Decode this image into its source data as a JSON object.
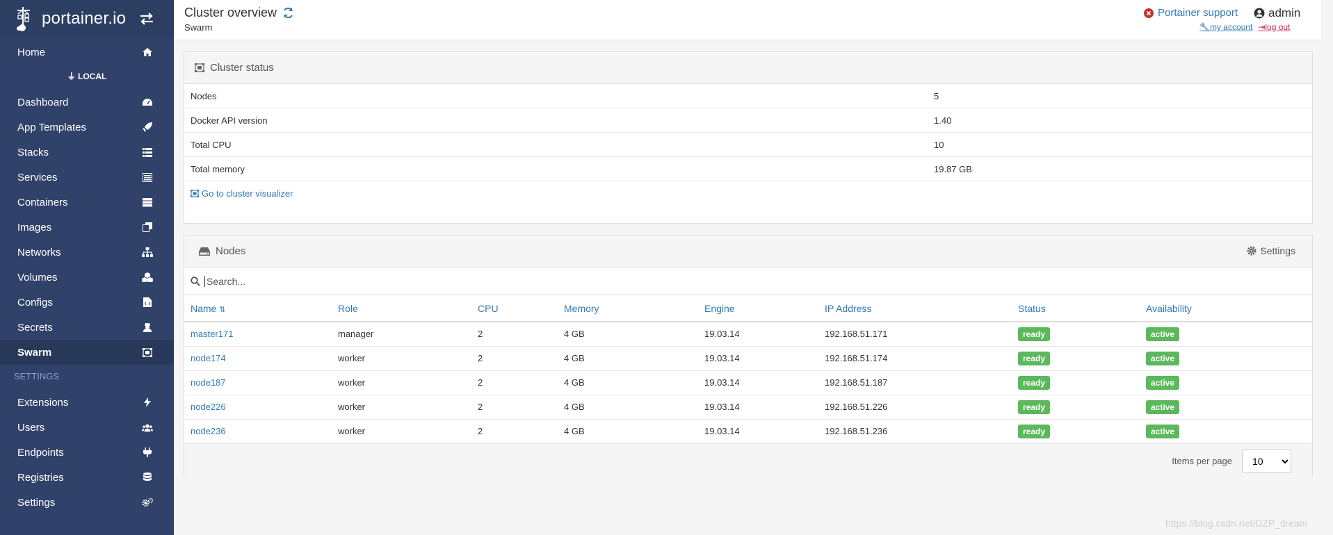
{
  "brand": {
    "name": "portainer.io"
  },
  "sidebar": {
    "home": "Home",
    "endpoint": "LOCAL",
    "items": [
      {
        "label": "Dashboard",
        "icon": "tachometer-icon"
      },
      {
        "label": "App Templates",
        "icon": "rocket-icon"
      },
      {
        "label": "Stacks",
        "icon": "th-list-icon"
      },
      {
        "label": "Services",
        "icon": "list-alt-icon"
      },
      {
        "label": "Containers",
        "icon": "server-icon"
      },
      {
        "label": "Images",
        "icon": "clone-icon"
      },
      {
        "label": "Networks",
        "icon": "sitemap-icon"
      },
      {
        "label": "Volumes",
        "icon": "cubes-icon"
      },
      {
        "label": "Configs",
        "icon": "file-code-icon"
      },
      {
        "label": "Secrets",
        "icon": "user-secret-icon"
      },
      {
        "label": "Swarm",
        "icon": "object-group-icon",
        "active": true
      }
    ],
    "settings_section": "SETTINGS",
    "settings_items": [
      {
        "label": "Extensions",
        "icon": "bolt-icon"
      },
      {
        "label": "Users",
        "icon": "users-icon"
      },
      {
        "label": "Endpoints",
        "icon": "plug-icon"
      },
      {
        "label": "Registries",
        "icon": "database-icon"
      },
      {
        "label": "Settings",
        "icon": "cogs-icon"
      }
    ]
  },
  "header": {
    "title": "Cluster overview",
    "breadcrumb": "Swarm",
    "support": "Portainer support",
    "user": "admin",
    "my_account": "my account",
    "log_out": "log out"
  },
  "cluster_status": {
    "title": "Cluster status",
    "rows": [
      {
        "key": "Nodes",
        "value": "5"
      },
      {
        "key": "Docker API version",
        "value": "1.40"
      },
      {
        "key": "Total CPU",
        "value": "10"
      },
      {
        "key": "Total memory",
        "value": "19.87 GB"
      }
    ],
    "visualizer_link": "Go to cluster visualizer"
  },
  "nodes": {
    "title": "Nodes",
    "settings": "Settings",
    "search_placeholder": "Search...",
    "columns": [
      "Name",
      "Role",
      "CPU",
      "Memory",
      "Engine",
      "IP Address",
      "Status",
      "Availability"
    ],
    "rows": [
      {
        "name": "master171",
        "role": "manager",
        "cpu": "2",
        "memory": "4 GB",
        "engine": "19.03.14",
        "ip": "192.168.51.171",
        "status": "ready",
        "availability": "active"
      },
      {
        "name": "node174",
        "role": "worker",
        "cpu": "2",
        "memory": "4 GB",
        "engine": "19.03.14",
        "ip": "192.168.51.174",
        "status": "ready",
        "availability": "active"
      },
      {
        "name": "node187",
        "role": "worker",
        "cpu": "2",
        "memory": "4 GB",
        "engine": "19.03.14",
        "ip": "192.168.51.187",
        "status": "ready",
        "availability": "active"
      },
      {
        "name": "node226",
        "role": "worker",
        "cpu": "2",
        "memory": "4 GB",
        "engine": "19.03.14",
        "ip": "192.168.51.226",
        "status": "ready",
        "availability": "active"
      },
      {
        "name": "node236",
        "role": "worker",
        "cpu": "2",
        "memory": "4 GB",
        "engine": "19.03.14",
        "ip": "192.168.51.236",
        "status": "ready",
        "availability": "active"
      }
    ],
    "items_per_page_label": "Items per page",
    "items_per_page": "10"
  },
  "watermark": "https://blog.csdn.net/DZP_dream",
  "colors": {
    "sidebar": "#30426a",
    "link": "#337ab7",
    "badge": "#5cb85c"
  }
}
